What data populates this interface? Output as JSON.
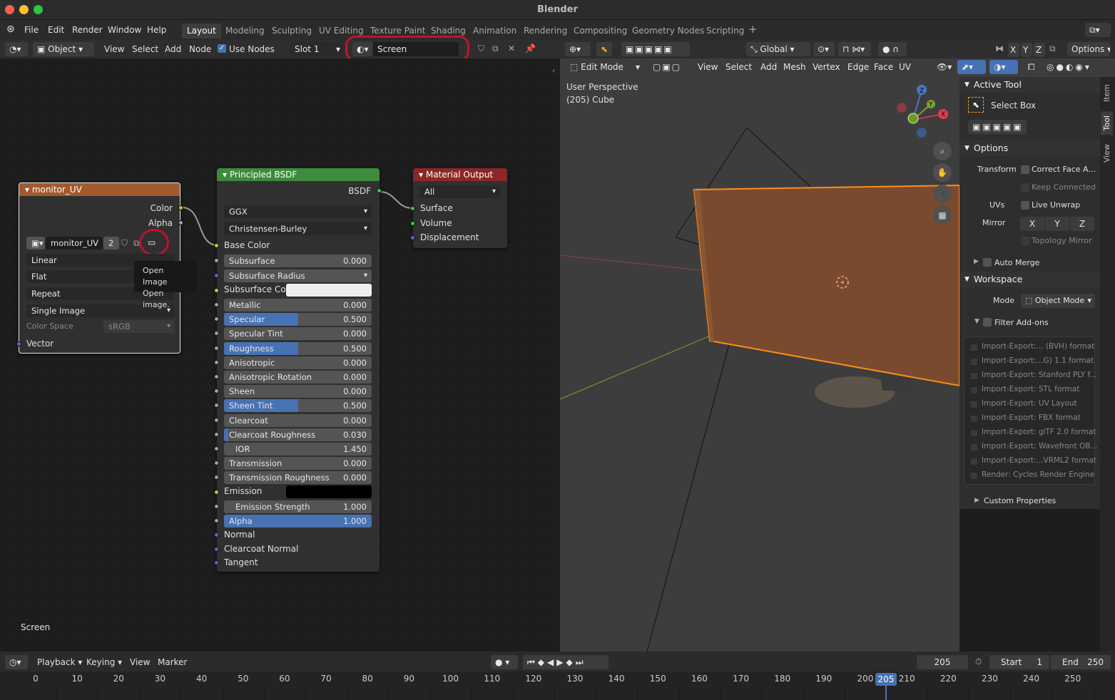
{
  "window": {
    "title": "Blender"
  },
  "menu": [
    "File",
    "Edit",
    "Render",
    "Window",
    "Help"
  ],
  "workspaces": [
    "Layout",
    "Modeling",
    "Sculpting",
    "UV Editing",
    "Texture Paint",
    "Shading",
    "Animation",
    "Rendering",
    "Compositing",
    "Geometry Nodes",
    "Scripting"
  ],
  "node_header": {
    "object": "Object",
    "view": "View",
    "select": "Select",
    "add": "Add",
    "node": "Node",
    "use_nodes": "Use Nodes",
    "slot": "Slot 1",
    "material": "Screen"
  },
  "image_node": {
    "title": "monitor_UV",
    "out_color": "Color",
    "out_alpha": "Alpha",
    "image_name": "monitor_UV",
    "users": "2",
    "interp": "Linear",
    "proj": "Flat",
    "ext": "Repeat",
    "source": "Single Image",
    "cs_label": "Color Space",
    "cs_value": "sRGB",
    "in_vector": "Vector"
  },
  "tooltip": {
    "line1": "Open Image",
    "line2": "Open image."
  },
  "bsdf": {
    "title": "Principled BSDF",
    "out": "BSDF",
    "dist": "GGX",
    "sss_method": "Christensen-Burley",
    "base_color": "Base Color",
    "subsurface": "Subsurface",
    "subsurface_val": "0.000",
    "subsurface_radius": "Subsurface Radius",
    "subsurface_color": "Subsurface Co...",
    "rows": [
      {
        "label": "Metallic",
        "value": "0.000",
        "fill": 0
      },
      {
        "label": "Specular",
        "value": "0.500",
        "fill": 0.5
      },
      {
        "label": "Specular Tint",
        "value": "0.000",
        "fill": 0
      },
      {
        "label": "Roughness",
        "value": "0.500",
        "fill": 0.5
      },
      {
        "label": "Anisotropic",
        "value": "0.000",
        "fill": 0
      },
      {
        "label": "Anisotropic Rotation",
        "value": "0.000",
        "fill": 0
      },
      {
        "label": "Sheen",
        "value": "0.000",
        "fill": 0
      },
      {
        "label": "Sheen Tint",
        "value": "0.500",
        "fill": 0.5
      },
      {
        "label": "Clearcoat",
        "value": "0.000",
        "fill": 0
      },
      {
        "label": "Clearcoat Roughness",
        "value": "0.030",
        "fill": 0.03
      },
      {
        "label": "IOR",
        "value": "1.450",
        "fill": 0
      },
      {
        "label": "Transmission",
        "value": "0.000",
        "fill": 0
      },
      {
        "label": "Transmission Roughness",
        "value": "0.000",
        "fill": 0
      }
    ],
    "emission": "Emission",
    "emission_strength": "Emission Strength",
    "emission_strength_val": "1.000",
    "alpha": "Alpha",
    "alpha_val": "1.000",
    "normal": "Normal",
    "clearcoat_normal": "Clearcoat Normal",
    "tangent": "Tangent"
  },
  "mat_output": {
    "title": "Material Output",
    "target": "All",
    "surface": "Surface",
    "volume": "Volume",
    "displacement": "Displacement"
  },
  "node_footer": "Screen",
  "view3d_header": {
    "orientation": "Global",
    "options": "Options",
    "axes": [
      "X",
      "Y",
      "Z"
    ],
    "mode": "Edit Mode",
    "menus": [
      "View",
      "Select",
      "Add",
      "Mesh",
      "Vertex",
      "Edge",
      "Face",
      "UV"
    ]
  },
  "viewport": {
    "persp": "User Perspective",
    "obj": "(205) Cube"
  },
  "npanel": {
    "tabs": [
      "Item",
      "Tool",
      "View"
    ],
    "active_tool": "Active Tool",
    "select_box": "Select Box",
    "options": "Options",
    "transform": "Transform",
    "correct_face": "Correct Face A...",
    "keep_connected": "Keep Connected",
    "uvs": "UVs",
    "live_unwrap": "Live Unwrap",
    "mirror": "Mirror",
    "mx": "X",
    "my": "Y",
    "mz": "Z",
    "topology_mirror": "Topology Mirror",
    "auto_merge": "Auto Merge",
    "workspace": "Workspace",
    "mode_label": "Mode",
    "mode_value": "Object Mode",
    "filter_addons": "Filter Add-ons",
    "addons": [
      "Import-Export:... (BVH) format",
      "Import-Export:...G) 1.1 format",
      "Import-Export: Stanford PLY f...",
      "Import-Export: STL format",
      "Import-Export: UV Layout",
      "Import-Export: FBX format",
      "Import-Export: glTF 2.0 format",
      "Import-Export: Wavefront OB...",
      "Import-Export:...VRML2 format",
      "Render: Cycles Render Engine"
    ],
    "custom_props": "Custom Properties"
  },
  "timeline": {
    "playback": "Playback",
    "keying": "Keying",
    "view": "View",
    "marker": "Marker",
    "current": "205",
    "start_label": "Start",
    "start": "1",
    "end_label": "End",
    "end": "250",
    "ticks": [
      "0",
      "10",
      "20",
      "30",
      "40",
      "50",
      "60",
      "70",
      "80",
      "90",
      "100",
      "110",
      "120",
      "130",
      "140",
      "150",
      "160",
      "170",
      "180",
      "190",
      "200",
      "210",
      "220",
      "230",
      "240",
      "250"
    ],
    "playhead": "205"
  }
}
